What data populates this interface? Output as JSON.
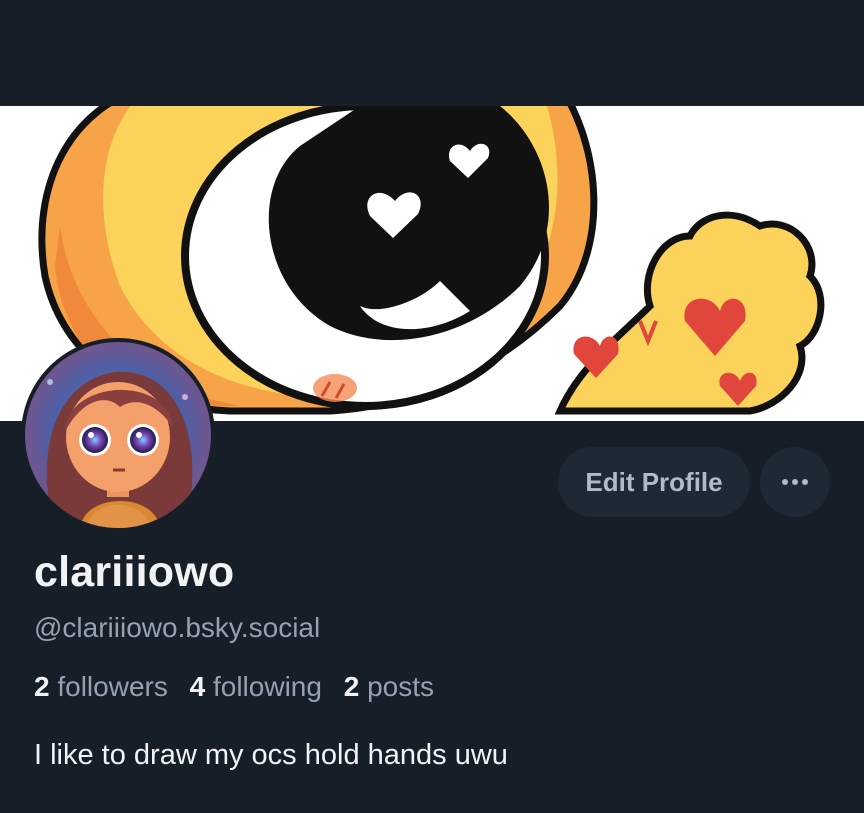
{
  "profile": {
    "display_name": "clariiiowo",
    "handle": "@clariiiowo.bsky.social",
    "bio": "I like to draw my ocs hold hands uwu"
  },
  "stats": {
    "followers_count": "2",
    "followers_label": "followers",
    "following_count": "4",
    "following_label": "following",
    "posts_count": "2",
    "posts_label": "posts"
  },
  "actions": {
    "edit_profile_label": "Edit Profile",
    "more_icon": "ellipsis-icon"
  },
  "colors": {
    "background": "#161e27",
    "button_bg": "#1e2936",
    "text_primary": "#f1f3f5",
    "text_secondary": "#93a2b3"
  }
}
